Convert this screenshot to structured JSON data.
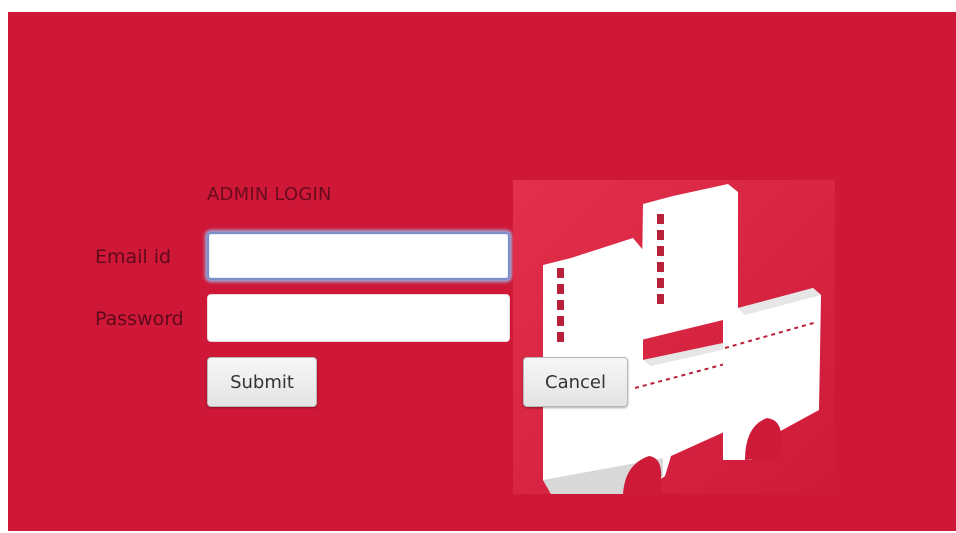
{
  "form": {
    "title": "ADMIN LOGIN",
    "email_label": "Email id",
    "email_value": "",
    "password_label": "Password",
    "password_value": ""
  },
  "buttons": {
    "submit_label": "Submit",
    "cancel_label": "Cancel"
  },
  "logo": {
    "icon": "chairs-logo-icon"
  },
  "colors": {
    "background": "#cf1838",
    "text": "#6a0b1d",
    "focus_border": "#7a8ec9"
  }
}
